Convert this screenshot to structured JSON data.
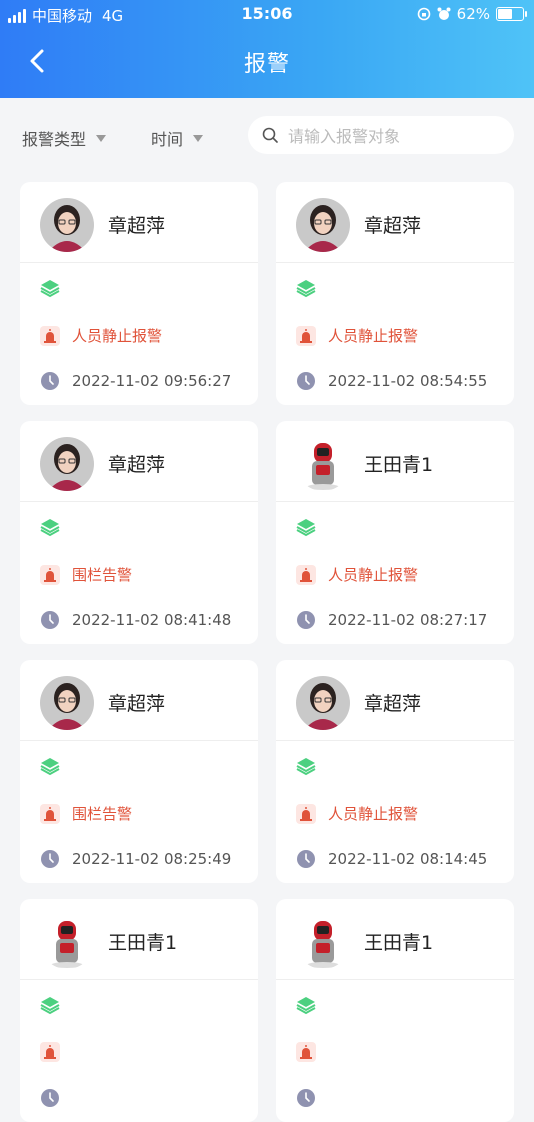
{
  "status_bar": {
    "carrier": "中国移动",
    "network": "4G",
    "time": "15:06",
    "battery": "62%",
    "battery_level": 0.62
  },
  "nav": {
    "title": "报警"
  },
  "filters": {
    "type_label": "报警类型",
    "time_label": "时间"
  },
  "search": {
    "placeholder": "请输入报警对象"
  },
  "colors": {
    "header_start": "#2f7cf6",
    "header_end": "#4fc3f7",
    "alarm_red": "#e0533a",
    "layer_green": "#4cd080"
  },
  "cards": [
    {
      "name": "章超萍",
      "avatar": "person-photo",
      "alarm": "人员静止报警",
      "time": "2022-11-02 09:56:27"
    },
    {
      "name": "章超萍",
      "avatar": "person-photo",
      "alarm": "人员静止报警",
      "time": "2022-11-02 08:54:55"
    },
    {
      "name": "章超萍",
      "avatar": "person-photo",
      "alarm": "围栏告警",
      "time": "2022-11-02 08:41:48"
    },
    {
      "name": "王田青1",
      "avatar": "robot-photo",
      "alarm": "人员静止报警",
      "time": "2022-11-02 08:27:17"
    },
    {
      "name": "章超萍",
      "avatar": "person-photo",
      "alarm": "围栏告警",
      "time": "2022-11-02 08:25:49"
    },
    {
      "name": "章超萍",
      "avatar": "person-photo",
      "alarm": "人员静止报警",
      "time": "2022-11-02 08:14:45"
    },
    {
      "name": "王田青1",
      "avatar": "robot-photo",
      "alarm": "",
      "time": ""
    },
    {
      "name": "王田青1",
      "avatar": "robot-photo",
      "alarm": "",
      "time": ""
    }
  ]
}
